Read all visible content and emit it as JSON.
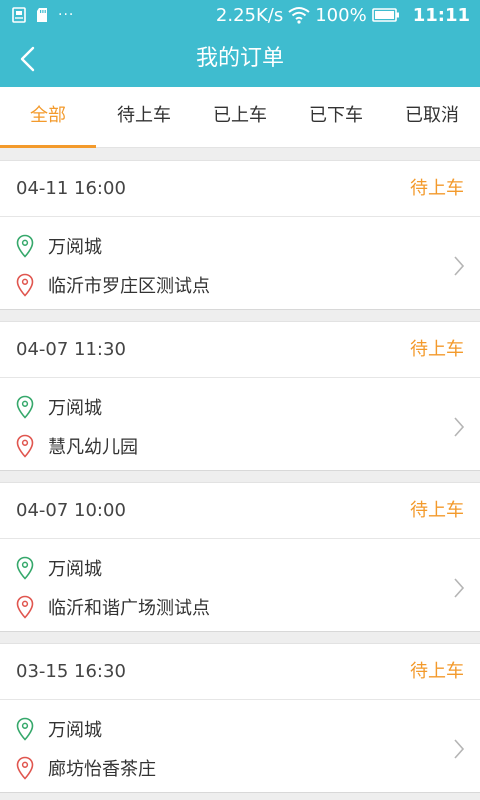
{
  "status_bar": {
    "net_speed": "2.25K/s",
    "battery_pct": "100%",
    "time": "11:11",
    "left_icons": [
      "notification-box-icon",
      "sd-card-icon",
      "more-ellipsis-icon"
    ],
    "ellipsis": "···"
  },
  "app_bar": {
    "title": "我的订单",
    "back_icon": "chevron-left-icon"
  },
  "tabs": [
    {
      "label": "全部",
      "active": true
    },
    {
      "label": "待上车",
      "active": false
    },
    {
      "label": "已上车",
      "active": false
    },
    {
      "label": "已下车",
      "active": false
    },
    {
      "label": "已取消",
      "active": false
    }
  ],
  "orders": [
    {
      "time": "04-11 16:00",
      "status": "待上车",
      "from": "万阅城",
      "to": "临沂市罗庄区测试点"
    },
    {
      "time": "04-07 11:30",
      "status": "待上车",
      "from": "万阅城",
      "to": "慧凡幼儿园"
    },
    {
      "time": "04-07 10:00",
      "status": "待上车",
      "from": "万阅城",
      "to": "临沂和谐广场测试点"
    },
    {
      "time": "03-15 16:30",
      "status": "待上车",
      "from": "万阅城",
      "to": "廊坊怡香茶庄"
    }
  ],
  "colors": {
    "primary": "#3fbccf",
    "accent": "#f39a2c",
    "pin_start": "#36a86b",
    "pin_end": "#e0564f"
  }
}
